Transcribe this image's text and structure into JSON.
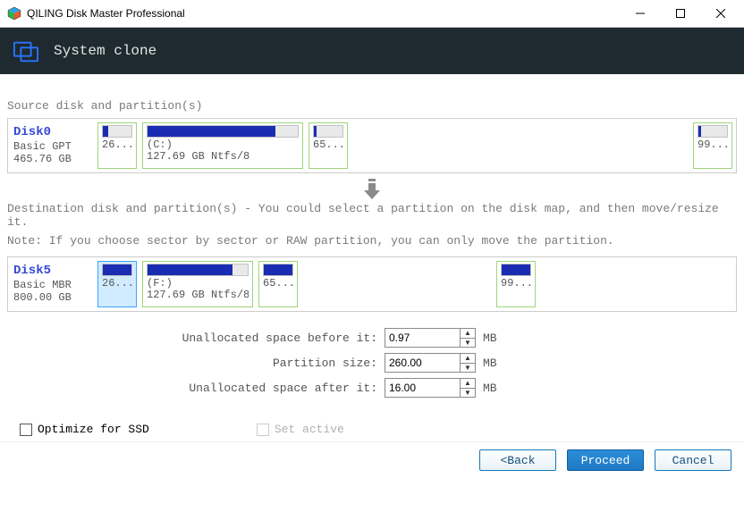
{
  "app": {
    "title": "QILING Disk Master Professional"
  },
  "header": {
    "title": "System clone"
  },
  "source": {
    "label": "Source disk and partition(s)",
    "disk": {
      "name": "Disk0",
      "type": "Basic GPT",
      "size": "465.76 GB"
    },
    "partitions": [
      {
        "fillPct": 20,
        "line1": "26...",
        "line2": ""
      },
      {
        "fillPct": 85,
        "line1": "(C:)",
        "line2": "127.69 GB Ntfs/8"
      },
      {
        "fillPct": 10,
        "line1": "65...",
        "line2": ""
      },
      {
        "fillPct": 10,
        "line1": "99...",
        "line2": ""
      }
    ]
  },
  "dest": {
    "heading": "Destination disk and partition(s) - You could select a partition on the disk map, and then move/resize it.",
    "note": "Note: If you choose sector by sector or RAW partition, you can only move the partition.",
    "disk": {
      "name": "Disk5",
      "type": "Basic MBR",
      "size": "800.00 GB"
    },
    "partitions": [
      {
        "fillPct": 100,
        "line1": "26...",
        "line2": ""
      },
      {
        "fillPct": 85,
        "line1": "(F:)",
        "line2": "127.69 GB Ntfs/8"
      },
      {
        "fillPct": 100,
        "line1": "65...",
        "line2": ""
      },
      {
        "fillPct": 100,
        "line1": "99...",
        "line2": ""
      }
    ]
  },
  "form": {
    "before": {
      "label": "Unallocated space before it:",
      "value": "0.97",
      "unit": "MB"
    },
    "size": {
      "label": "Partition size:",
      "value": "260.00",
      "unit": "MB"
    },
    "after": {
      "label": "Unallocated space after it:",
      "value": "16.00",
      "unit": "MB"
    }
  },
  "options": {
    "optimize_ssd": "Optimize for SSD",
    "set_active": "Set active"
  },
  "footer": {
    "back": "<Back",
    "proceed": "Proceed",
    "cancel": "Cancel"
  }
}
